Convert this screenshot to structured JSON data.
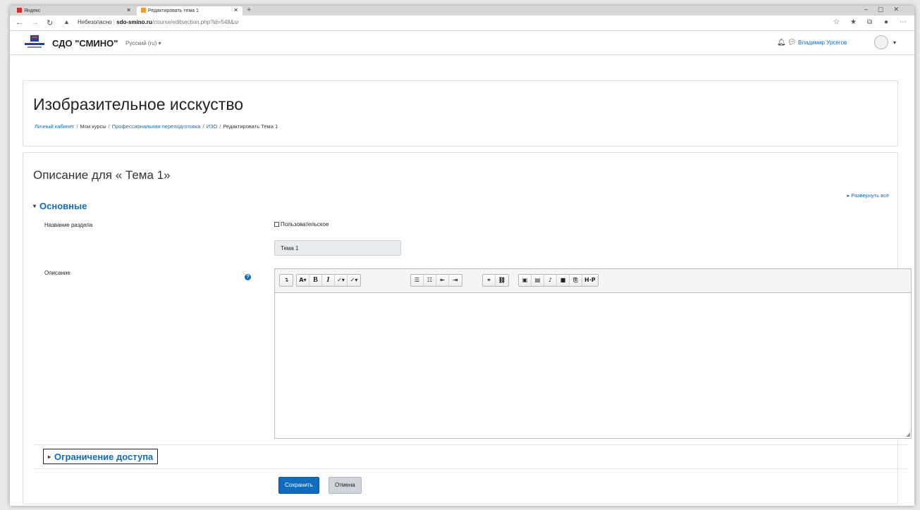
{
  "browser": {
    "tabs": [
      {
        "label": "Яндекс",
        "icon": "yandex-icon"
      },
      {
        "label": "Редактировать тема 1",
        "icon": "moodle-icon"
      }
    ],
    "security_label": "Небезопасно",
    "url_domain": "sdo-smino.ru",
    "url_path": "/course/editsection.php?id=548&sr"
  },
  "navbar": {
    "brand": "СДО \"СМИНО\"",
    "language": "Русский (ru)",
    "user_name": "Владимир Урсегов"
  },
  "header": {
    "title": "Изобразительное исскуство",
    "breadcrumb": [
      {
        "label": "Личный кабинет",
        "link": true
      },
      {
        "label": "Мои курсы",
        "link": false
      },
      {
        "label": "Профессиональная переподготовка",
        "link": true
      },
      {
        "label": "ИЗО",
        "link": true
      },
      {
        "label": "Редактировать Тема 1",
        "link": false
      }
    ]
  },
  "form": {
    "title": "Описание для « Тема 1»",
    "expand_all": "Развернуть всё",
    "section_general": "Основные",
    "section_name_label": "Название раздела",
    "custom_checkbox_label": "Пользовательское",
    "section_name_value": "Тема 1",
    "description_label": "Описание",
    "section_restrict": "Ограничение доступа",
    "save_label": "Сохранить",
    "cancel_label": "Отмена"
  },
  "colors": {
    "accent": "#0f6cbf",
    "cancel_bg": "#ced4da"
  }
}
